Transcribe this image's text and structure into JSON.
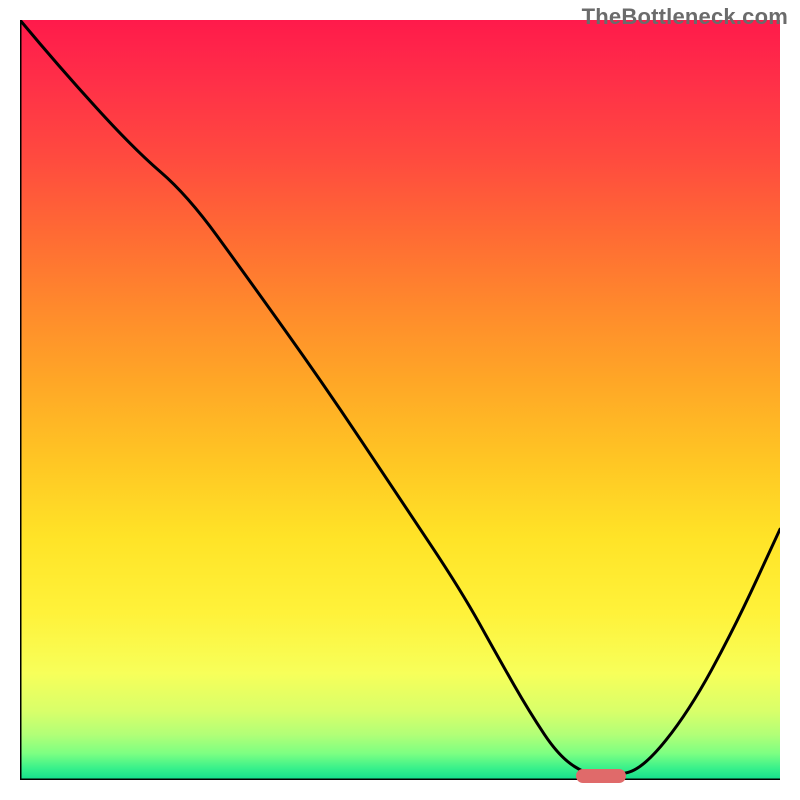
{
  "watermark": "TheBottleneck.com",
  "colors": {
    "gradient_top": "#ff1a4b",
    "gradient_bottom": "#12dc8d",
    "plateau_bar": "#e06a6a",
    "curve": "#000000",
    "axes": "#000000",
    "watermark_text": "#6b6b6b"
  },
  "chart_data": {
    "type": "line",
    "title": "",
    "xlabel": "",
    "ylabel": "",
    "xlim": [
      0,
      100
    ],
    "ylim": [
      0,
      100
    ],
    "series": [
      {
        "name": "bottleneck-curve",
        "x": [
          0,
          5,
          15,
          22,
          30,
          40,
          50,
          58,
          63,
          67,
          71,
          75,
          78,
          82,
          88,
          94,
          100
        ],
        "y": [
          100,
          94,
          83,
          77,
          66,
          52,
          37,
          25,
          16,
          9,
          3,
          0.5,
          0.5,
          1.5,
          9,
          20,
          33
        ]
      }
    ],
    "annotations": [
      {
        "name": "plateau-bar",
        "x": 76.5,
        "y": 0.5
      }
    ]
  }
}
